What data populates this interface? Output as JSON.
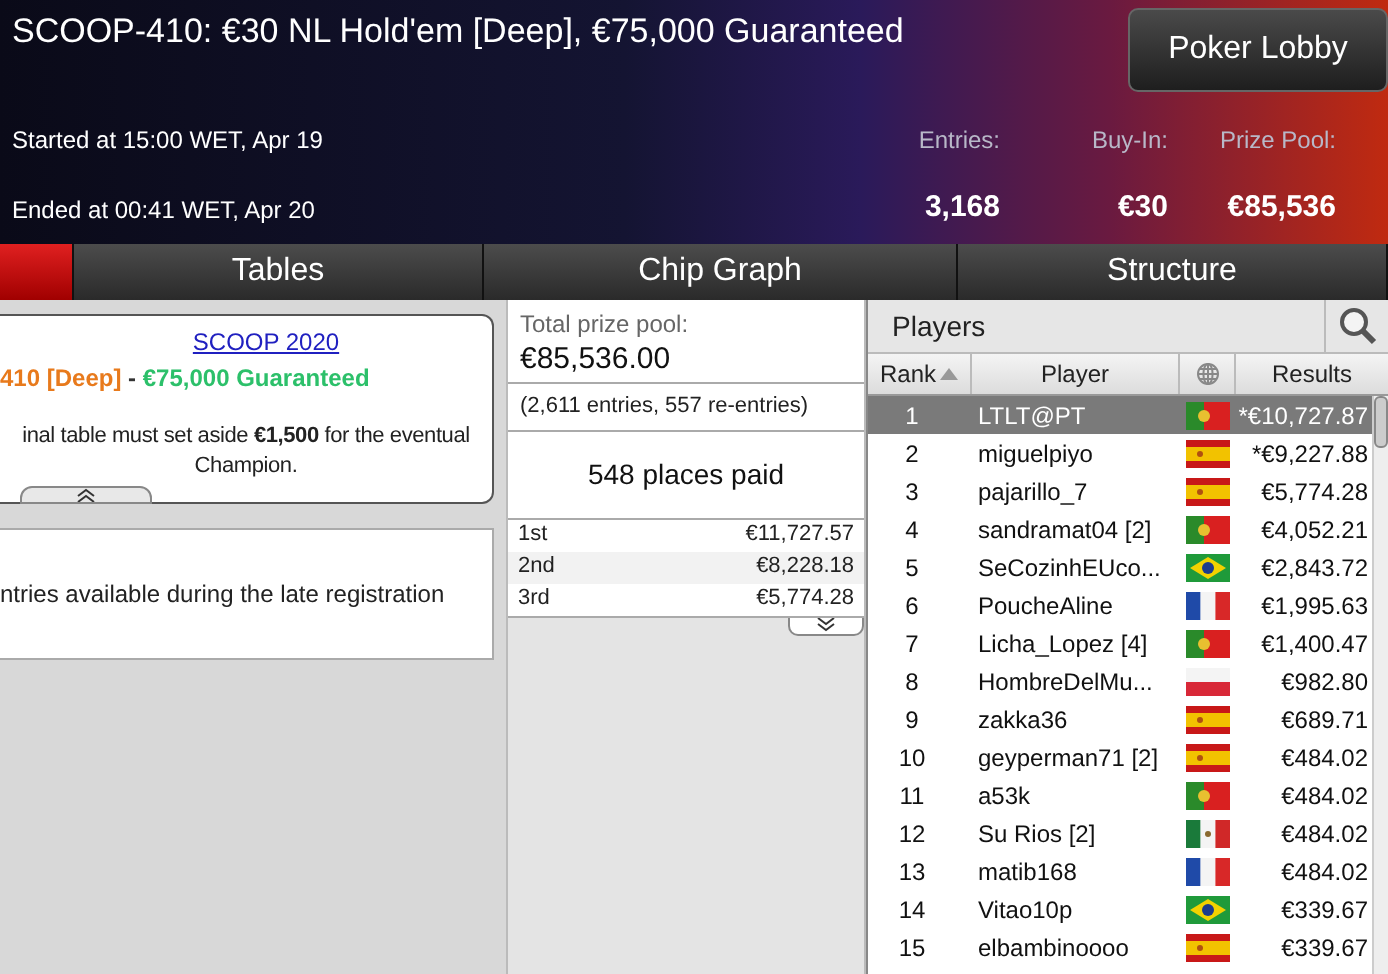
{
  "header": {
    "title": "SCOOP-410: €30 NL Hold'em [Deep], €75,000 Guaranteed",
    "lobby_button": "Poker Lobby",
    "started": "Started at 15:00 WET, Apr 19",
    "ended": "Ended at 00:41 WET, Apr 20",
    "stats": [
      {
        "label": "Entries:",
        "value": "3,168"
      },
      {
        "label": "Buy-In:",
        "value": "€30"
      },
      {
        "label": "Prize Pool:",
        "value": "€85,536"
      }
    ]
  },
  "tabs": [
    {
      "selected": true
    },
    {
      "label": "Tables",
      "selected": false
    },
    {
      "label": "Chip Graph",
      "selected": false
    },
    {
      "label": "Structure",
      "selected": false
    }
  ],
  "info": {
    "link": "SCOOP 2020",
    "subtitle": [
      {
        "kind": "deep",
        "text": "410 [Deep]"
      },
      {
        "kind": "plain",
        "text": " - "
      },
      {
        "kind": "guarantee",
        "text": "€75,000 Guaranteed"
      }
    ],
    "note": "inal table must set aside **€1,500** for the eventual Champion.",
    "reentry": "ntries available during the late registration"
  },
  "prizes": {
    "label": "Total prize pool:",
    "total": "€85,536.00",
    "entries": "(2,611 entries, 557 re-entries)",
    "places": "548 places paid",
    "rows": [
      {
        "place": "1st",
        "amount": "€11,727.57"
      },
      {
        "place": "2nd",
        "amount": "€8,228.18"
      },
      {
        "place": "3rd",
        "amount": "€5,774.28"
      }
    ]
  },
  "players": {
    "title": "Players",
    "columns": [
      "Rank",
      "Player",
      "Results"
    ],
    "rows": [
      {
        "rank": "1",
        "name": "LTLT@PT",
        "kind": "pt",
        "result": "*€10,727.87",
        "selected": true
      },
      {
        "rank": "2",
        "name": "miguelpiyo",
        "kind": "es",
        "result": "*€9,227.88",
        "selected": false
      },
      {
        "rank": "3",
        "name": "pajarillo_7",
        "kind": "es",
        "result": "€5,774.28",
        "selected": false
      },
      {
        "rank": "4",
        "name": "sandramat04 [2]",
        "kind": "pt",
        "result": "€4,052.21",
        "selected": false
      },
      {
        "rank": "5",
        "name": "SeCozinhEUco...",
        "kind": "br",
        "result": "€2,843.72",
        "selected": false
      },
      {
        "rank": "6",
        "name": "PoucheAline",
        "kind": "fr",
        "result": "€1,995.63",
        "selected": false
      },
      {
        "rank": "7",
        "name": "Licha_Lopez [4]",
        "kind": "pt",
        "result": "€1,400.47",
        "selected": false
      },
      {
        "rank": "8",
        "name": "HombreDelMu...",
        "kind": "pl",
        "result": "€982.80",
        "selected": false
      },
      {
        "rank": "9",
        "name": "zakka36",
        "kind": "es",
        "result": "€689.71",
        "selected": false
      },
      {
        "rank": "10",
        "name": "geyperman71 [2]",
        "kind": "es",
        "result": "€484.02",
        "selected": false
      },
      {
        "rank": "11",
        "name": "a53k",
        "kind": "pt",
        "result": "€484.02",
        "selected": false
      },
      {
        "rank": "12",
        "name": "Su Rios [2]",
        "kind": "mx",
        "result": "€484.02",
        "selected": false
      },
      {
        "rank": "13",
        "name": "matib168",
        "kind": "fr",
        "result": "€484.02",
        "selected": false
      },
      {
        "rank": "14",
        "name": "Vitao10p",
        "kind": "br",
        "result": "€339.67",
        "selected": false
      },
      {
        "rank": "15",
        "name": "elbambinoooo",
        "kind": "es",
        "result": "€339.67",
        "selected": false
      }
    ]
  }
}
